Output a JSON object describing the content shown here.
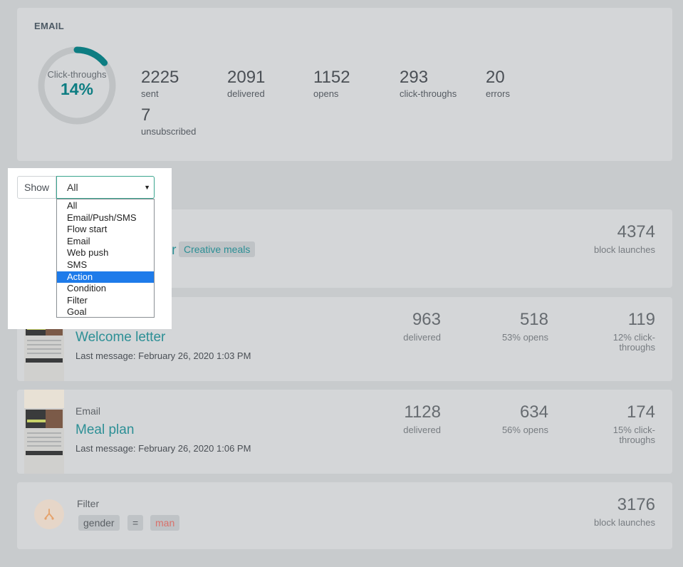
{
  "summary": {
    "title": "EMAIL",
    "donut_label": "Click-throughs",
    "donut_value": "14%",
    "donut_fraction": 0.14,
    "accent": "#0d7d82",
    "stats": [
      {
        "num": "2225",
        "label": "sent"
      },
      {
        "num": "2091",
        "label": "delivered"
      },
      {
        "num": "1152",
        "label": "opens"
      },
      {
        "num": "293",
        "label": "click-throughs"
      },
      {
        "num": "20",
        "label": "errors"
      },
      {
        "num": "7",
        "label": "unsubscribed"
      }
    ]
  },
  "filter": {
    "show_label": "Show",
    "selected": "All",
    "options": [
      "All",
      "Email/Push/SMS",
      "Flow start",
      "Email",
      "Web push",
      "SMS",
      "Action",
      "Condition",
      "Filter",
      "Goal"
    ],
    "highlighted": "Action"
  },
  "flow_start": {
    "icon": "enter-icon",
    "partial_title": "ber",
    "tag": "Creative meals",
    "launches": "4374",
    "launches_label": "block launches"
  },
  "emails": [
    {
      "kind": "Email",
      "name": "Welcome letter",
      "last_message": "Last message: February 26, 2020 1:03 PM",
      "delivered": "963",
      "delivered_label": "delivered",
      "opens": "518",
      "opens_label": "53% opens",
      "clicks": "119",
      "clicks_label_1": "12% click-",
      "clicks_label_2": "throughs"
    },
    {
      "kind": "Email",
      "name": "Meal plan",
      "last_message": "Last message: February 26, 2020 1:06 PM",
      "delivered": "1128",
      "delivered_label": "delivered",
      "opens": "634",
      "opens_label": "56% opens",
      "clicks": "174",
      "clicks_label_1": "15% click-",
      "clicks_label_2": "throughs"
    }
  ],
  "filter_block": {
    "icon": "split-icon",
    "title": "Filter",
    "field": "gender",
    "operator": "=",
    "value": "man",
    "launches": "3176",
    "launches_label": "block launches"
  }
}
